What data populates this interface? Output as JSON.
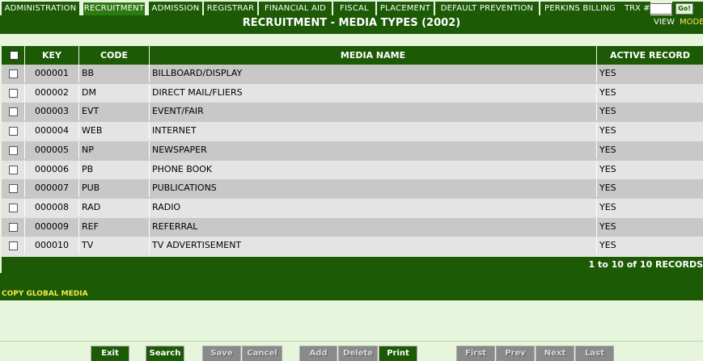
{
  "nav": {
    "tabs": [
      {
        "key": "administration",
        "label": "ADMINISTRATION",
        "active": false
      },
      {
        "key": "recruitment",
        "label": "RECRUITMENT",
        "active": true
      },
      {
        "key": "admission",
        "label": "ADMISSION",
        "active": false
      },
      {
        "key": "registrar",
        "label": "REGISTRAR",
        "active": false
      },
      {
        "key": "financial-aid",
        "label": "FINANCIAL AID",
        "active": false
      },
      {
        "key": "fiscal",
        "label": "FISCAL",
        "active": false
      },
      {
        "key": "placement",
        "label": "PLACEMENT",
        "active": false
      },
      {
        "key": "default-prevention",
        "label": "DEFAULT PREVENTION",
        "active": false
      },
      {
        "key": "perkins-billing",
        "label": "PERKINS BILLING",
        "active": false
      }
    ],
    "trx_label": "TRX #:",
    "trx_value": "",
    "go_label": "Go!"
  },
  "title": "RECRUITMENT - MEDIA TYPES (2002)",
  "view_label": "VIEW",
  "mode_label": "MODE",
  "table": {
    "columns": [
      "KEY",
      "CODE",
      "MEDIA NAME",
      "ACTIVE RECORD"
    ],
    "rows": [
      {
        "key": "000001",
        "code": "BB",
        "name": "BILLBOARD/DISPLAY",
        "active": "YES"
      },
      {
        "key": "000002",
        "code": "DM",
        "name": "DIRECT MAIL/FLIERS",
        "active": "YES"
      },
      {
        "key": "000003",
        "code": "EVT",
        "name": "EVENT/FAIR",
        "active": "YES"
      },
      {
        "key": "000004",
        "code": "WEB",
        "name": "INTERNET",
        "active": "YES"
      },
      {
        "key": "000005",
        "code": "NP",
        "name": "NEWSPAPER",
        "active": "YES"
      },
      {
        "key": "000006",
        "code": "PB",
        "name": "PHONE BOOK",
        "active": "YES"
      },
      {
        "key": "000007",
        "code": "PUB",
        "name": "PUBLICATIONS",
        "active": "YES"
      },
      {
        "key": "000008",
        "code": "RAD",
        "name": "RADIO",
        "active": "YES"
      },
      {
        "key": "000009",
        "code": "REF",
        "name": "REFERRAL",
        "active": "YES"
      },
      {
        "key": "000010",
        "code": "TV",
        "name": "TV ADVERTISEMENT",
        "active": "YES"
      }
    ]
  },
  "records_text": "1 to 10 of 10 RECORDS",
  "copy_global_label": "COPY GLOBAL MEDIA",
  "buttons": [
    {
      "key": "exit",
      "label": "Exit",
      "enabled": true
    },
    {
      "key": "search",
      "label": "Search",
      "enabled": true
    },
    {
      "key": "save",
      "label": "Save",
      "enabled": false
    },
    {
      "key": "cancel",
      "label": "Cancel",
      "enabled": false
    },
    {
      "key": "add",
      "label": "Add",
      "enabled": false
    },
    {
      "key": "delete",
      "label": "Delete",
      "enabled": false
    },
    {
      "key": "print",
      "label": "Print",
      "enabled": true
    },
    {
      "key": "first",
      "label": "First",
      "enabled": false
    },
    {
      "key": "prev",
      "label": "Prev",
      "enabled": false
    },
    {
      "key": "next",
      "label": "Next",
      "enabled": false
    },
    {
      "key": "last",
      "label": "Last",
      "enabled": false
    }
  ],
  "colors": {
    "primary_green": "#1c5a06",
    "page_background": "#e6f5dc",
    "highlight_yellow": "#f3e94a",
    "row_dark": "#c8c8c8",
    "row_light": "#e4e4e4",
    "disabled_button": "#8a8a8a"
  }
}
